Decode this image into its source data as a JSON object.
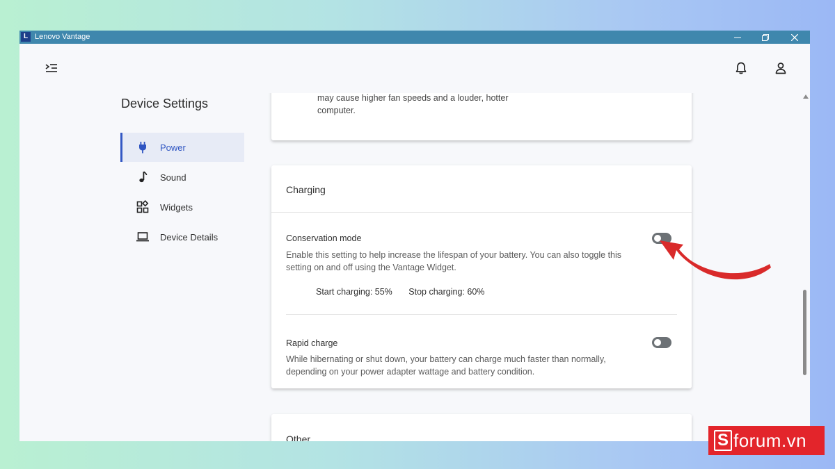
{
  "window": {
    "title": "Lenovo Vantage",
    "logo_letter": "L"
  },
  "sidebar": {
    "title": "Device Settings",
    "items": [
      {
        "label": "Power",
        "icon": "plug-icon",
        "active": true
      },
      {
        "label": "Sound",
        "icon": "music-note-icon",
        "active": false
      },
      {
        "label": "Widgets",
        "icon": "widgets-icon",
        "active": false
      },
      {
        "label": "Device Details",
        "icon": "laptop-icon",
        "active": false
      }
    ]
  },
  "cards": {
    "previous_text": "may cause higher fan speeds and a louder, hotter computer.",
    "charging": {
      "header": "Charging",
      "conservation": {
        "title": "Conservation mode",
        "description": "Enable this setting to help increase the lifespan of your battery. You can also toggle this setting on and off using the Vantage Widget.",
        "start_charging": "Start charging: 55%",
        "stop_charging": "Stop charging: 60%",
        "enabled": false
      },
      "rapid": {
        "title": "Rapid charge",
        "description": "While hibernating or shut down, your battery can charge much faster than normally, depending on your power adapter wattage and battery condition.",
        "enabled": false
      }
    },
    "other": {
      "header": "Other"
    }
  },
  "watermark": {
    "letter": "S",
    "text": "forum.vn"
  },
  "colors": {
    "titlebar": "#3f87ad",
    "accent": "#2f55c2",
    "arrow": "#d92a2a",
    "watermark": "#e3252b"
  }
}
